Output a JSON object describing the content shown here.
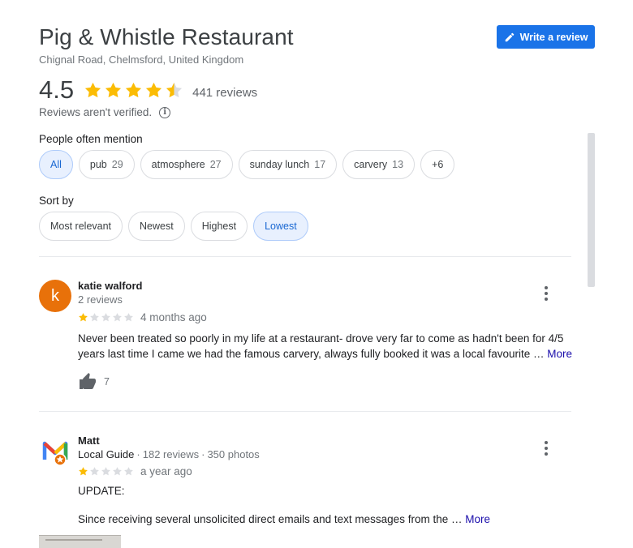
{
  "place": {
    "title": "Pig & Whistle Restaurant",
    "address": "Chignal Road, Chelmsford, United Kingdom",
    "write_review_label": "Write a review",
    "write_review_icon": "pencil-icon",
    "rating": "4.5",
    "rating_value": 4.5,
    "review_count": "441 reviews",
    "verified_note": "Reviews aren't verified.",
    "info_icon": "info-icon"
  },
  "mentions": {
    "label": "People often mention",
    "chips": [
      {
        "label": "All",
        "count": "",
        "selected": true
      },
      {
        "label": "pub",
        "count": "29",
        "selected": false
      },
      {
        "label": "atmosphere",
        "count": "27",
        "selected": false
      },
      {
        "label": "sunday lunch",
        "count": "17",
        "selected": false
      },
      {
        "label": "carvery",
        "count": "13",
        "selected": false
      },
      {
        "label": "+6",
        "count": "",
        "selected": false
      }
    ]
  },
  "sort": {
    "label": "Sort by",
    "options": [
      {
        "label": "Most relevant",
        "selected": false
      },
      {
        "label": "Newest",
        "selected": false
      },
      {
        "label": "Highest",
        "selected": false
      },
      {
        "label": "Lowest",
        "selected": true
      }
    ]
  },
  "reviews": [
    {
      "avatar_letter": "k",
      "avatar_color": "#e8710a",
      "name": "katie walford",
      "meta": "2 reviews",
      "stars": 1,
      "time": "4 months ago",
      "text": "Never been treated so poorly in my life at a restaurant- drove very far to come as hadn't been for 4/5 years last time I came we had the famous carvery, always fully booked it was a local favourite …",
      "more_label": "More",
      "likes": "7",
      "like_icon": "thumbs-up-icon",
      "menu_icon": "more-vert-icon"
    },
    {
      "avatar_letter": "M",
      "avatar_style": "multicolor-m-local-guide",
      "name": "Matt",
      "guide": "Local Guide",
      "reviews_count": "182 reviews",
      "photos_count": "350 photos",
      "stars": 1,
      "time": "a year ago",
      "text_line1": "UPDATE:",
      "text_line2": "Since receiving several unsolicited direct emails and text messages from the …",
      "more_label": "More",
      "menu_icon": "more-vert-icon"
    }
  ],
  "colors": {
    "star": "#fbbc04",
    "star_empty": "#dadce0",
    "accent": "#1a73e8",
    "link": "#1a0dab"
  }
}
